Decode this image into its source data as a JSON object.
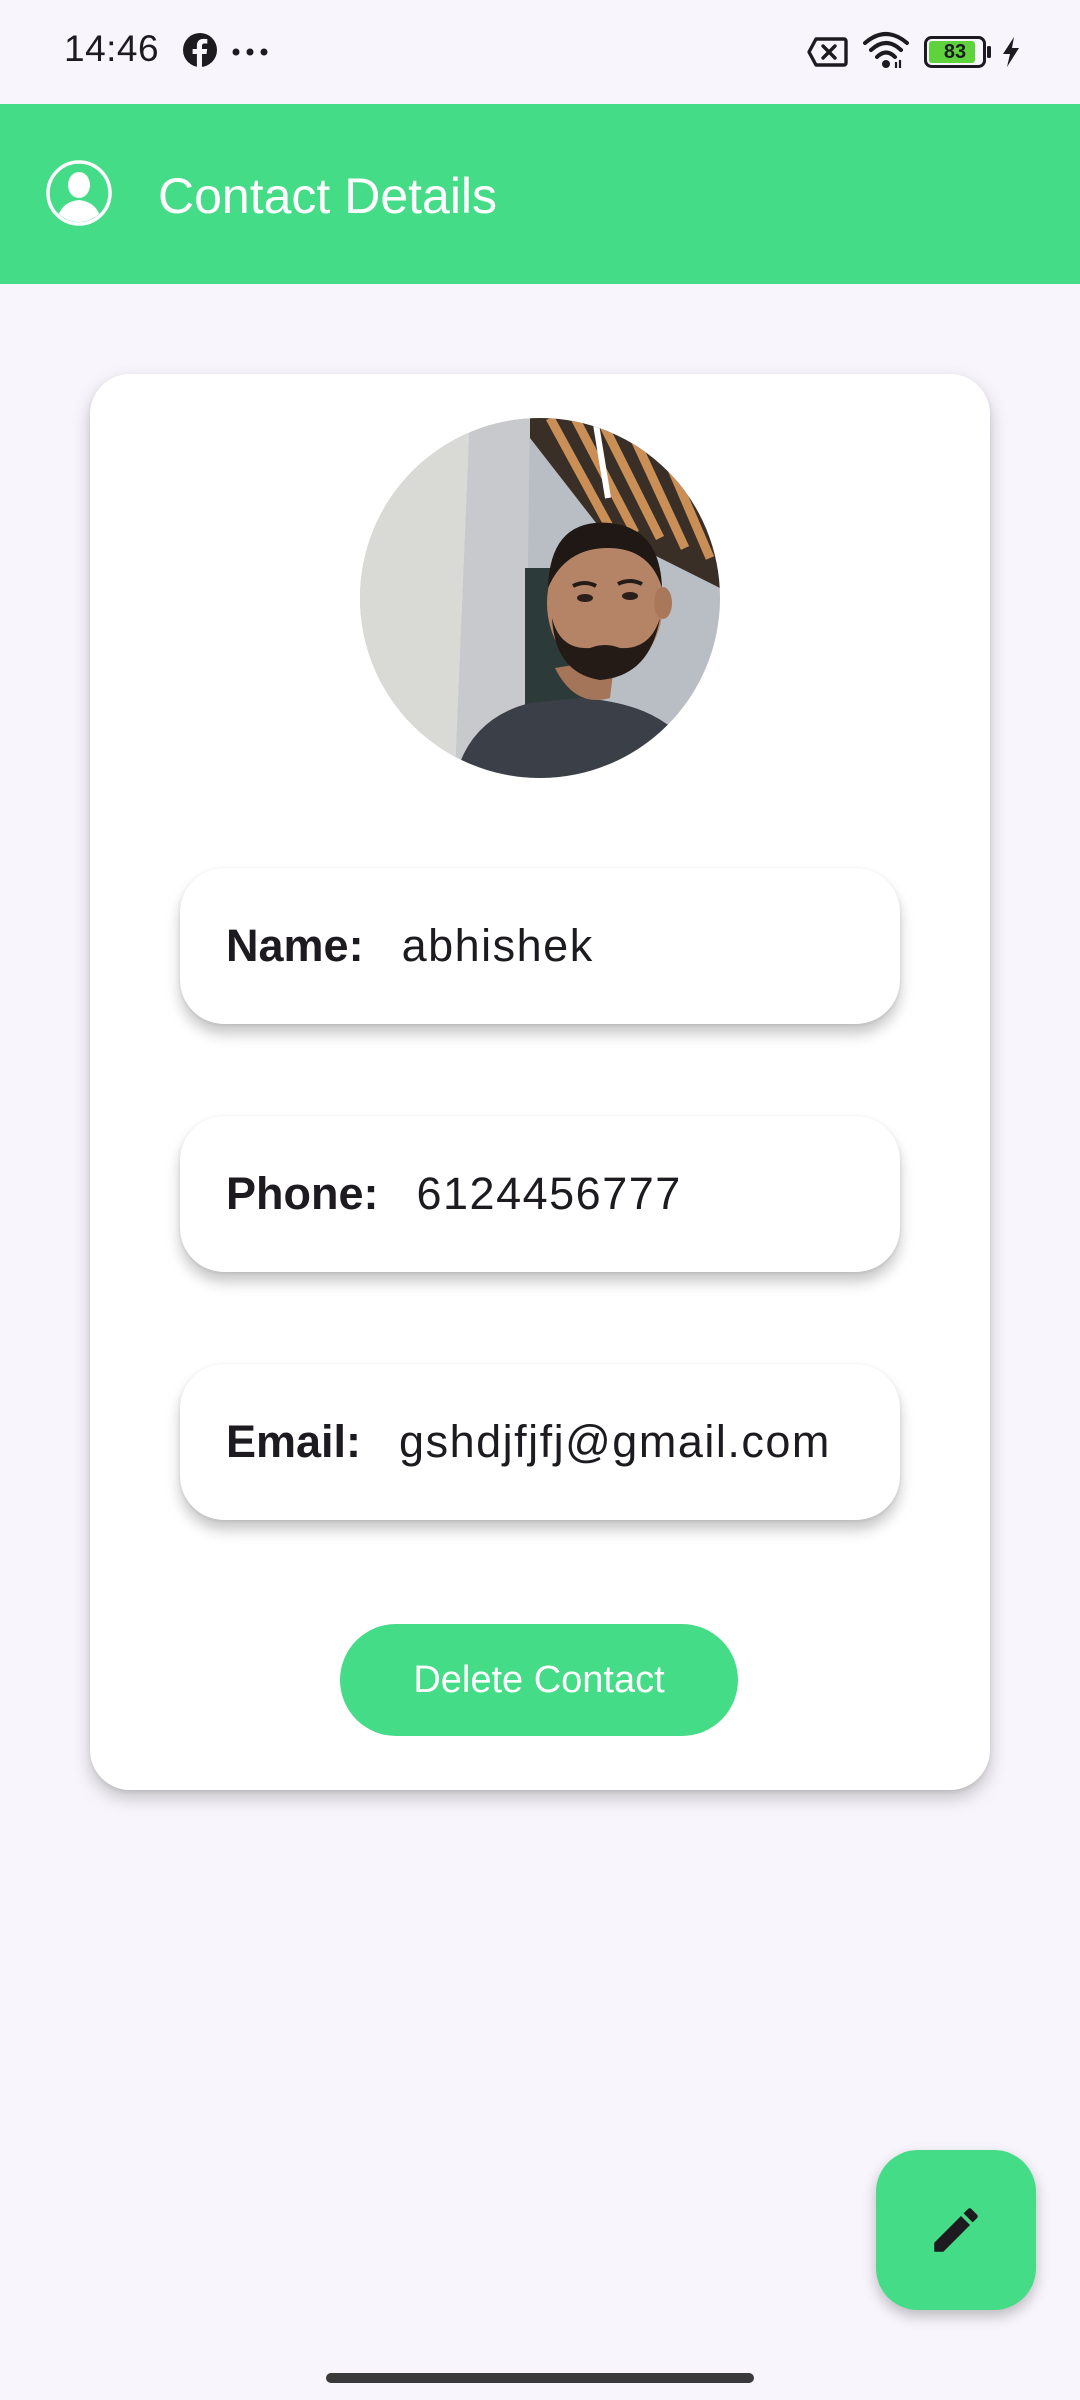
{
  "status_bar": {
    "time": "14:46",
    "icons": [
      "facebook-icon",
      "more-dots-icon",
      "no-sim-icon",
      "wifi-icon",
      "battery-icon",
      "charging-bolt-icon"
    ],
    "battery_level": "83"
  },
  "app_bar": {
    "title": "Contact Details",
    "icon": "account-circle-icon",
    "color": "#44dc87"
  },
  "contact": {
    "photo_icon": "contact-photo",
    "fields": {
      "name": {
        "label": "Name:",
        "value": "abhishek"
      },
      "phone": {
        "label": "Phone:",
        "value": "6124456777"
      },
      "email": {
        "label": "Email:",
        "value": "gshdjfjfj@gmail.com"
      }
    },
    "delete_label": "Delete Contact"
  },
  "fab": {
    "icon": "edit-pencil-icon"
  },
  "colors": {
    "accent": "#44dc87",
    "background": "#f8f6fc",
    "card": "#ffffff",
    "text": "#1d1b20"
  }
}
